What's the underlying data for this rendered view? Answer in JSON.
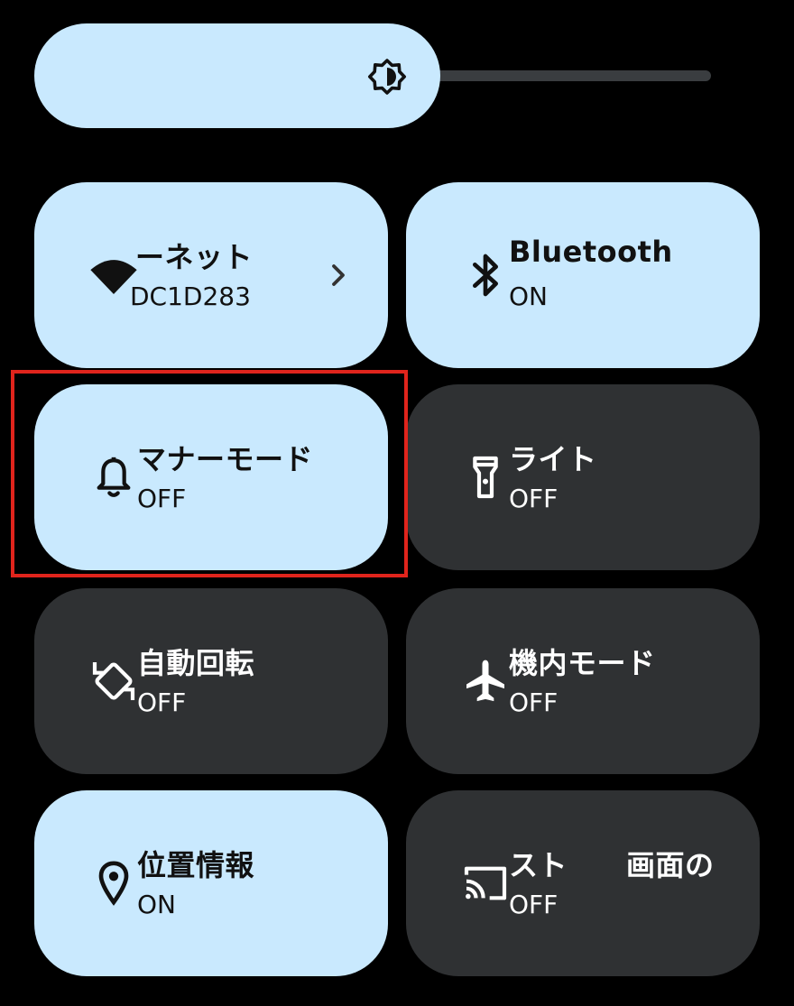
{
  "brightness": {
    "level": 0.6,
    "icon": "brightness-icon"
  },
  "tiles": [
    {
      "id": "internet",
      "title": "ーネット",
      "subtitle": "DC1D283",
      "state": "on",
      "icon": "wifi-icon",
      "has_chevron": true
    },
    {
      "id": "bluetooth",
      "title": "Bluetooth",
      "subtitle": "ON",
      "state": "on",
      "icon": "bluetooth-icon"
    },
    {
      "id": "manner",
      "title": "マナーモード",
      "subtitle": "OFF",
      "state": "on",
      "icon": "bell-icon",
      "highlighted": true
    },
    {
      "id": "flashlight",
      "title": "ライト",
      "subtitle": "OFF",
      "state": "off",
      "icon": "flashlight-icon"
    },
    {
      "id": "autorotate",
      "title": "自動回転",
      "subtitle": "OFF",
      "state": "off",
      "icon": "rotate-icon"
    },
    {
      "id": "airplane",
      "title": "機内モード",
      "subtitle": "OFF",
      "state": "off",
      "icon": "airplane-icon"
    },
    {
      "id": "location",
      "title": "位置情報",
      "subtitle": "ON",
      "state": "on",
      "icon": "location-icon"
    },
    {
      "id": "cast",
      "title": "スト　　画面の",
      "subtitle": "OFF",
      "state": "off",
      "icon": "cast-icon"
    }
  ],
  "colors": {
    "tile_on": "#c9e9fe",
    "tile_off": "#2f3133",
    "highlight": "#e0241c"
  }
}
